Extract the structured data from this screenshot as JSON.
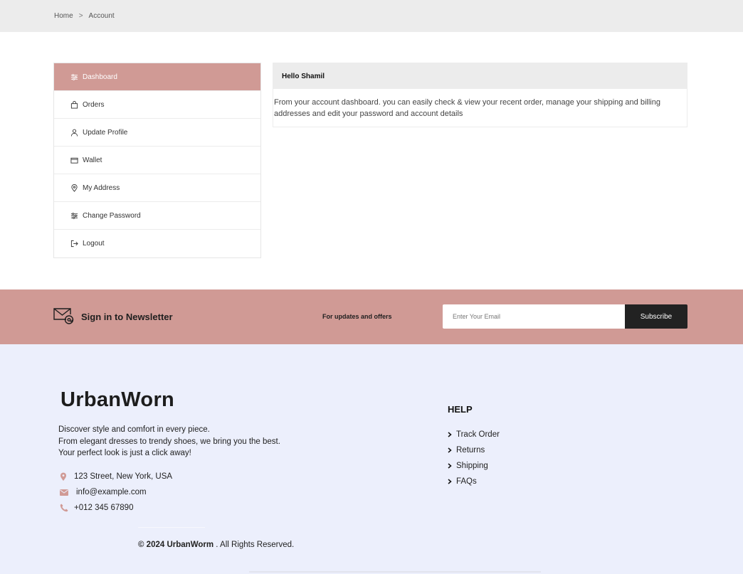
{
  "breadcrumb": {
    "home": "Home",
    "separator": ">",
    "current": "Account"
  },
  "sidebar": {
    "items": [
      {
        "label": "Dashboard",
        "icon": "sliders-icon",
        "active": true
      },
      {
        "label": "Orders",
        "icon": "bag-icon"
      },
      {
        "label": "Update Profile",
        "icon": "user-icon"
      },
      {
        "label": "Wallet",
        "icon": "wallet-icon"
      },
      {
        "label": "My Address",
        "icon": "location-pin-icon"
      },
      {
        "label": "Change Password",
        "icon": "sliders-icon"
      },
      {
        "label": "Logout",
        "icon": "logout-icon"
      }
    ]
  },
  "panel": {
    "title": "Hello Shamil",
    "body": "From your account dashboard. you can easily check & view your recent order, manage your shipping and billing addresses and edit your password and account details"
  },
  "newsletter": {
    "title": "Sign in to Newsletter",
    "subtitle": "For updates and offers",
    "placeholder": "Enter Your Email",
    "button": "Subscribe"
  },
  "footer": {
    "brand": "UrbanWorn",
    "desc_lines": [
      "Discover style and comfort in every piece.",
      "From elegant dresses to trendy shoes, we bring you the best.",
      "Your perfect look is just a click away!"
    ],
    "address": "123 Street, New York, USA",
    "email": "info@example.com",
    "phone": "+012 345 67890",
    "help_title": "HELP",
    "help_links": [
      "Track Order",
      "Returns",
      "Shipping",
      "FAQs"
    ],
    "copyright_prefix": "© 2024",
    "copyright_brand": "UrbanWorm",
    "copyright_suffix": ". All Rights Reserved."
  },
  "colors": {
    "accent": "#d09a95",
    "footer_bg": "#eceffc",
    "bar_bg": "#ececec",
    "button_bg": "#222222"
  }
}
